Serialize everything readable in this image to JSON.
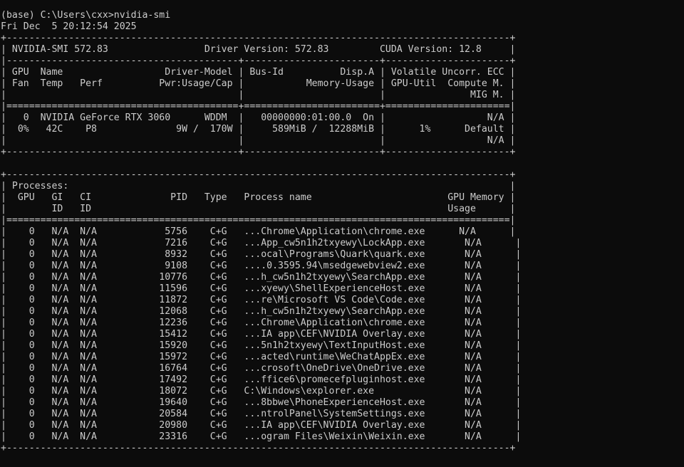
{
  "terminal": {
    "background": "#0c0c0c",
    "foreground": "#cccccc",
    "lines": [
      "(base) C:\\Users\\cxx>nvidia-smi",
      "Fri Dec  5 20:12:54 2025",
      "+-----------------------------------------------------------------------------------------+",
      "| NVIDIA-SMI 572.83                 Driver Version: 572.83         CUDA Version: 12.8     |",
      "|-----------------------------------------+------------------------+----------------------+",
      "| GPU  Name                  Driver-Model | Bus-Id          Disp.A | Volatile Uncorr. ECC |",
      "| Fan  Temp   Perf          Pwr:Usage/Cap |           Memory-Usage | GPU-Util  Compute M. |",
      "|                                         |                        |               MIG M. |",
      "|=========================================+========================+======================|",
      "|   0  NVIDIA GeForce RTX 3060      WDDM  |   00000000:01:00.0  On |                  N/A |",
      "|  0%   42C    P8              9W /  170W |     589MiB /  12288MiB |      1%      Default |",
      "|                                         |                        |                  N/A |",
      "+-----------------------------------------+------------------------+----------------------+",
      "",
      "+-----------------------------------------------------------------------------------------+",
      "| Processes:                                                                              |",
      "|  GPU   GI   CI              PID   Type   Process name                        GPU Memory |",
      "|        ID   ID                                                               Usage      |",
      "|=========================================================================================|",
      "|    0   N/A  N/A            5756    C+G   ...Chrome\\Application\\chrome.exe      N/A      |",
      "|    0   N/A  N/A            7216    C+G   ...App_cw5n1h2txyewy\\LockApp.exe       N/A      |",
      "|    0   N/A  N/A            8932    C+G   ...ocal\\Programs\\Quark\\quark.exe       N/A      |",
      "|    0   N/A  N/A            9108    C+G   ....0.3595.94\\msedgewebview2.exe       N/A      |",
      "|    0   N/A  N/A           10776    C+G   ...h_cw5n1h2txyewy\\SearchApp.exe       N/A      |",
      "|    0   N/A  N/A           11596    C+G   ...xyewy\\ShellExperienceHost.exe       N/A      |",
      "|    0   N/A  N/A           11872    C+G   ...re\\Microsoft VS Code\\Code.exe       N/A      |",
      "|    0   N/A  N/A           12068    C+G   ...h_cw5n1h2txyewy\\SearchApp.exe       N/A      |",
      "|    0   N/A  N/A           12236    C+G   ...Chrome\\Application\\chrome.exe       N/A      |",
      "|    0   N/A  N/A           15412    C+G   ...IA app\\CEF\\NVIDIA Overlay.exe       N/A      |",
      "|    0   N/A  N/A           15920    C+G   ...5n1h2txyewy\\TextInputHost.exe       N/A      |",
      "|    0   N/A  N/A           15972    C+G   ...acted\\runtime\\WeChatAppEx.exe       N/A      |",
      "|    0   N/A  N/A           16764    C+G   ...crosoft\\OneDrive\\OneDrive.exe       N/A      |",
      "|    0   N/A  N/A           17492    C+G   ...ffice6\\promecefpluginhost.exe       N/A      |",
      "|    0   N/A  N/A           18072    C+G   C:\\Windows\\explorer.exe                N/A      |",
      "|    0   N/A  N/A           19640    C+G   ...8bbwe\\PhoneExperienceHost.exe       N/A      |",
      "|    0   N/A  N/A           20584    C+G   ...ntrolPanel\\SystemSettings.exe       N/A      |",
      "|    0   N/A  N/A           20980    C+G   ...IA app\\CEF\\NVIDIA Overlay.exe       N/A      |",
      "|    0   N/A  N/A           23316    C+G   ...ogram Files\\Weixin\\Weixin.exe       N/A      |",
      "+-----------------------------------------------------------------------------------------+"
    ]
  }
}
